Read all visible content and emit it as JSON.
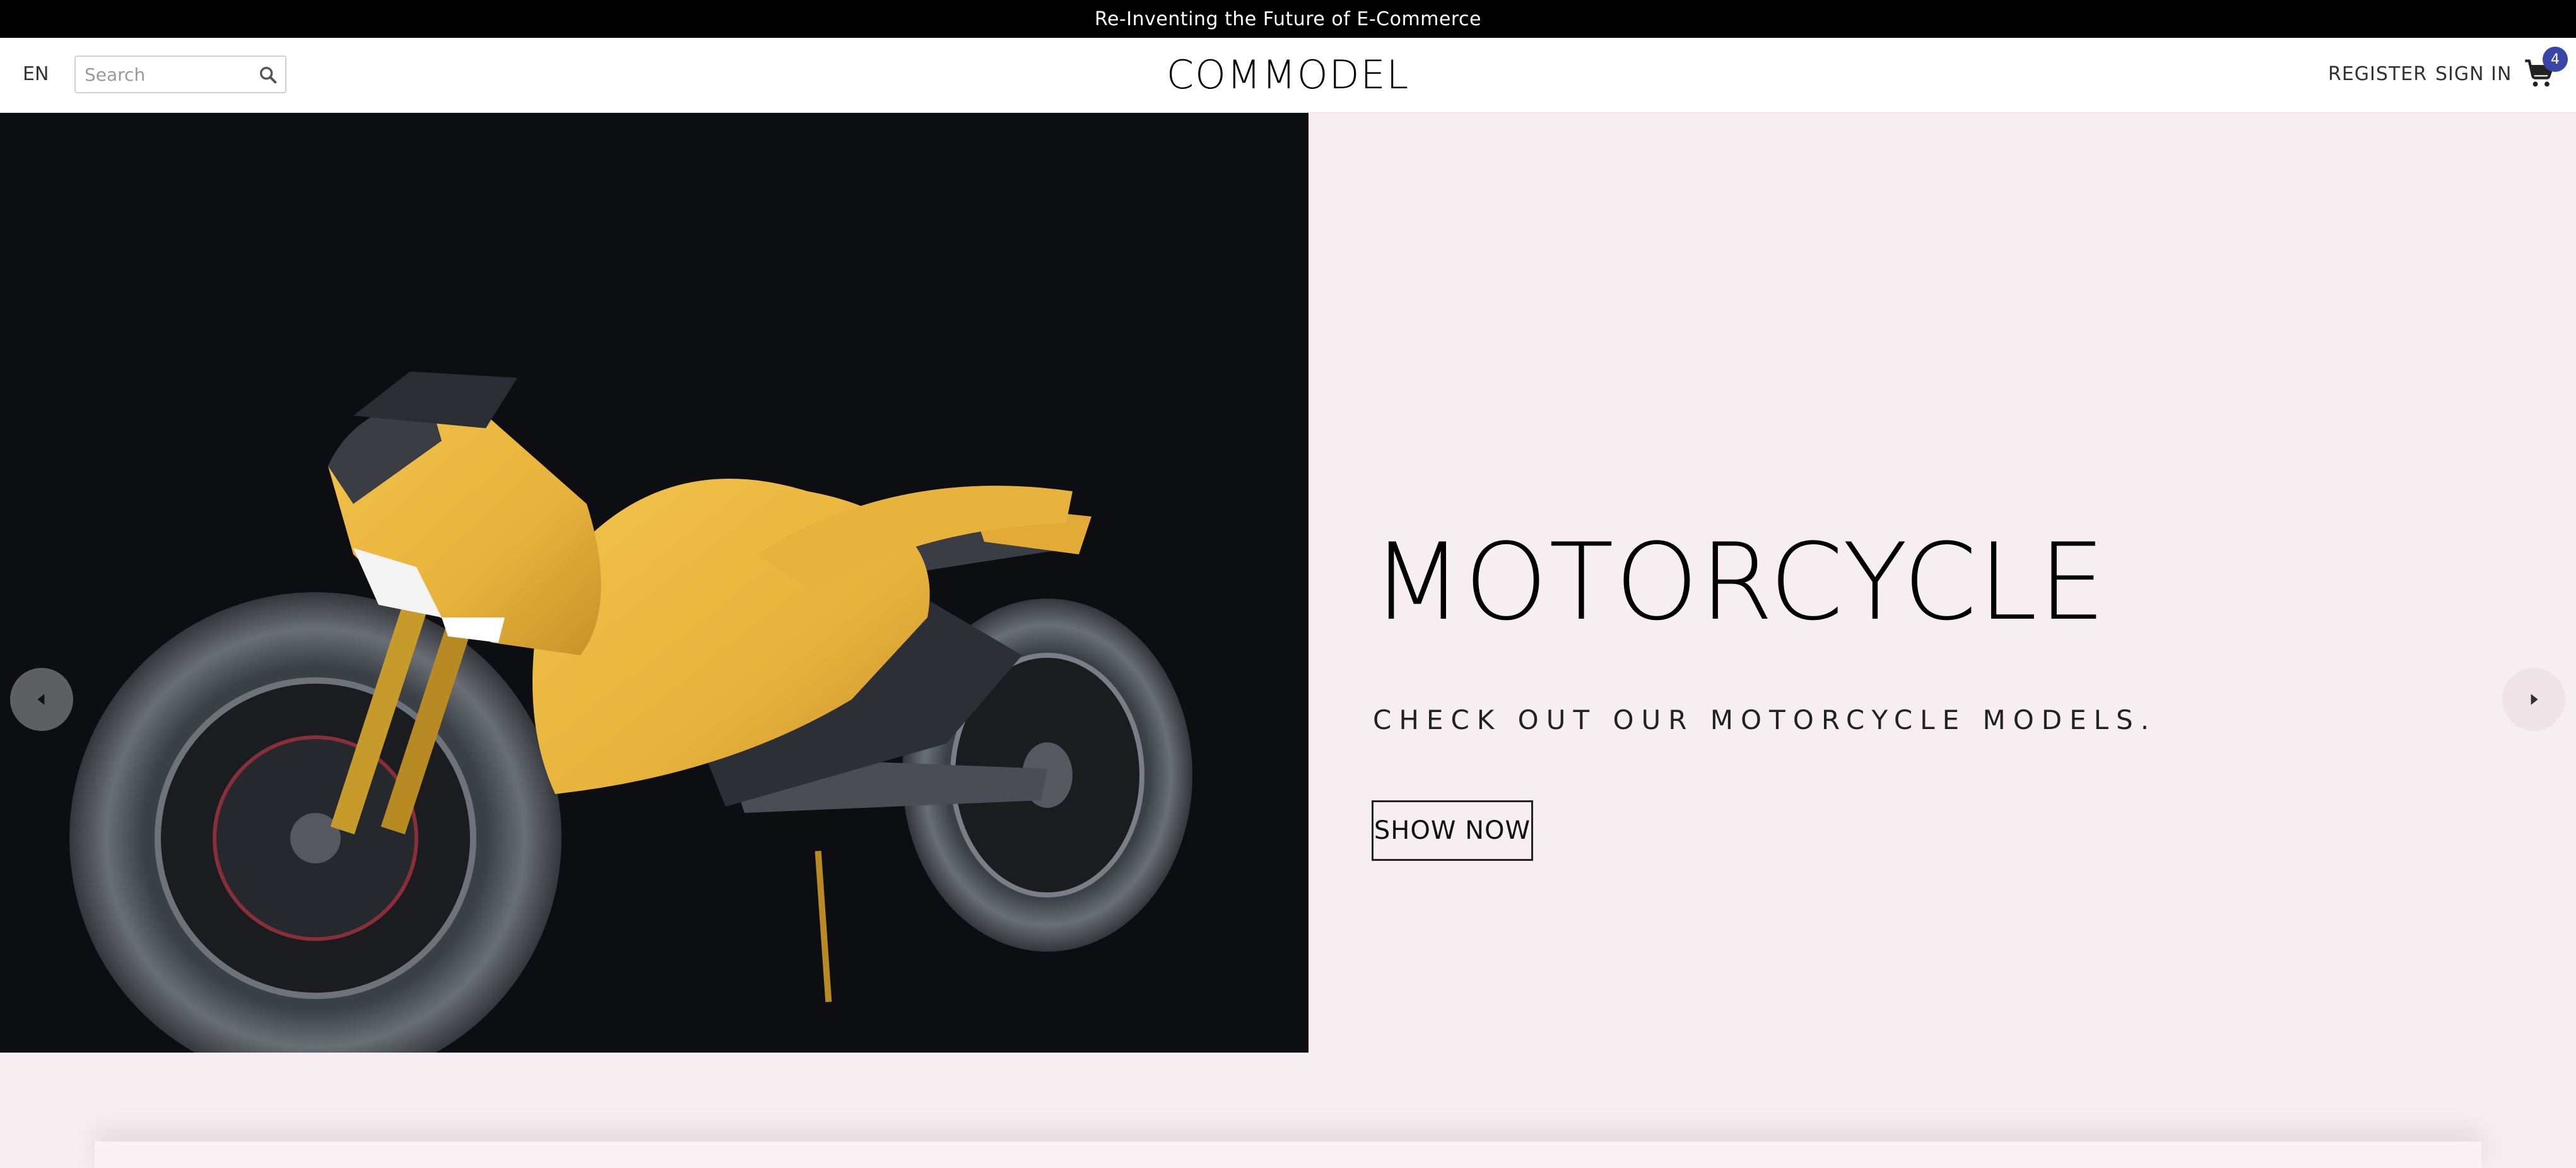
{
  "announcement": "Re-Inventing the Future of E-Commerce",
  "header": {
    "language": "EN",
    "search_placeholder": "Search",
    "search_icon": "search-icon",
    "logo": "COMMODEL",
    "register": "REGISTER",
    "sign_in": "SIGN IN",
    "cart_icon": "cart-icon",
    "cart_count": "4"
  },
  "hero": {
    "image_subject": "yellow electric motorcycle",
    "title": "MOTORCYCLE",
    "subtitle": "CHECK OUT OUR MOTORCYCLE MODELS.",
    "button": "SHOW NOW",
    "prev_icon": "chevron-left-icon",
    "next_icon": "chevron-right-icon"
  },
  "colors": {
    "announcement_bg": "#000000",
    "hero_text_bg": "#f7eef1",
    "hero_image_bg": "#0c0e12",
    "motorcycle_body": "#e8b33c",
    "badge": "#3a45a8"
  }
}
